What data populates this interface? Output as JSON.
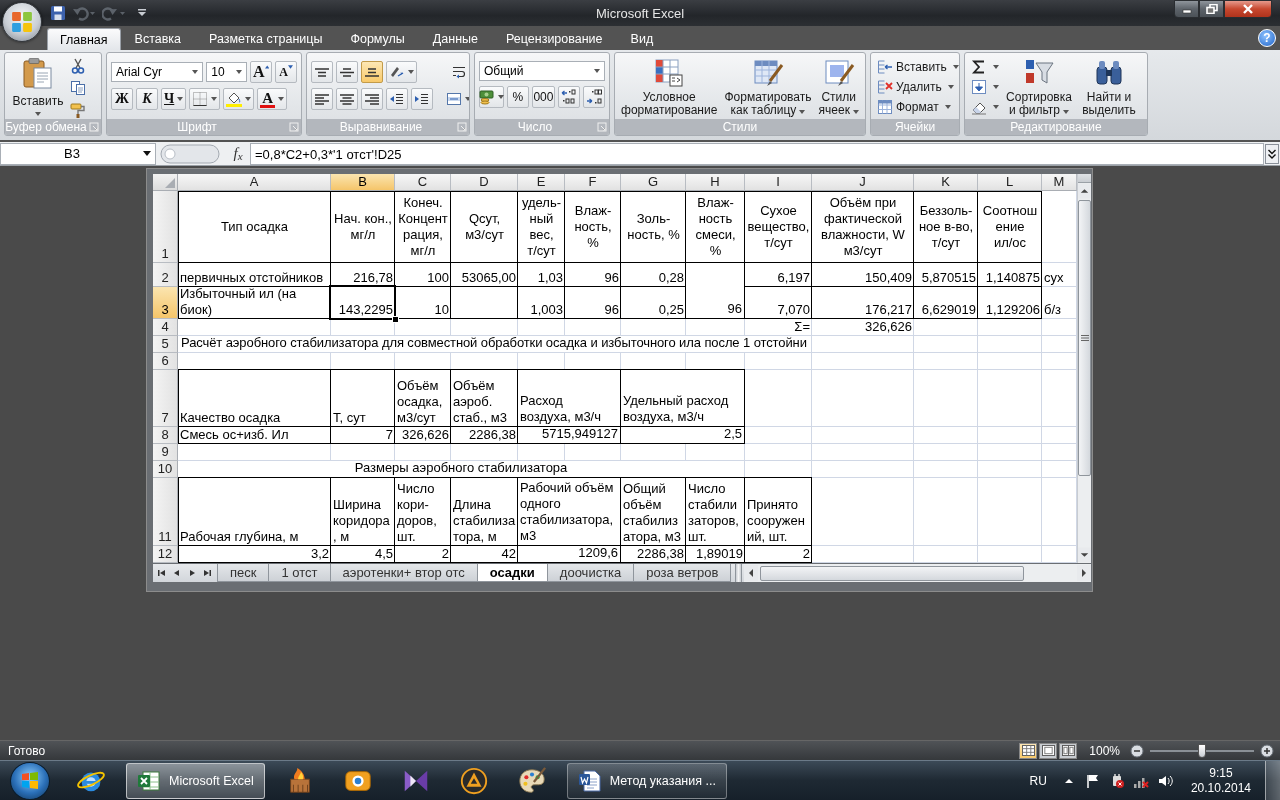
{
  "window": {
    "title": "Microsoft Excel"
  },
  "quick_access": [
    {
      "kind": "save",
      "disabled": false
    },
    {
      "kind": "undo",
      "disabled": true
    },
    {
      "kind": "redo",
      "disabled": true
    }
  ],
  "tabs": [
    {
      "label": "Главная",
      "selected": true
    },
    {
      "label": "Вставка",
      "selected": false
    },
    {
      "label": "Разметка страницы",
      "selected": false
    },
    {
      "label": "Формулы",
      "selected": false
    },
    {
      "label": "Данные",
      "selected": false
    },
    {
      "label": "Рецензирование",
      "selected": false
    },
    {
      "label": "Вид",
      "selected": false
    }
  ],
  "help": "?",
  "ribbon": {
    "clipboard": {
      "label": "Буфер обмена",
      "paste": "Вставить"
    },
    "font": {
      "label": "Шрифт",
      "name": "Arial Cyr",
      "size": "10",
      "grow": "A",
      "shrink": "A",
      "bold": "Ж",
      "italic": "К",
      "underline": "Ч",
      "foreground_letter": "A"
    },
    "alignment": {
      "label": "Выравнивание",
      "vertical": [
        {
          "kind": "top",
          "selected": false
        },
        {
          "kind": "middle",
          "selected": false
        },
        {
          "kind": "bottom",
          "selected": true
        }
      ],
      "horizontal": [
        {
          "kind": "left",
          "selected": false
        },
        {
          "kind": "center",
          "selected": false
        },
        {
          "kind": "right",
          "selected": false
        }
      ]
    },
    "number": {
      "label": "Число",
      "format": "Общий",
      "percent": "%",
      "thousands": "000"
    },
    "styles": {
      "label": "Стили",
      "buttons": [
        {
          "kind": "conditional",
          "label": "Условное форматирование"
        },
        {
          "kind": "table",
          "label": "Форматировать как таблицу"
        },
        {
          "kind": "cell_styles",
          "label": "Стили ячеек"
        }
      ]
    },
    "cells": {
      "label": "Ячейки",
      "buttons": [
        {
          "kind": "insert",
          "label": "Вставить"
        },
        {
          "kind": "delete",
          "label": "Удалить"
        },
        {
          "kind": "format",
          "label": "Формат"
        }
      ]
    },
    "editing": {
      "label": "Редактирование",
      "buttons": [
        {
          "kind": "sort",
          "label": "Сортировка и фильтр"
        },
        {
          "kind": "find",
          "label": "Найти и выделить"
        }
      ]
    }
  },
  "formula_bar": {
    "name_box": "B3",
    "function_button": "f$_{x}$",
    "formula": "=0,8*C2+0,3*'1 отст'!D25"
  },
  "sheet": {
    "columns": [
      {
        "label": "A",
        "selected": false
      },
      {
        "label": "B",
        "selected": true
      },
      {
        "label": "C",
        "selected": false
      },
      {
        "label": "D",
        "selected": false
      },
      {
        "label": "E",
        "selected": false
      },
      {
        "label": "F",
        "selected": false
      },
      {
        "label": "G",
        "selected": false
      },
      {
        "label": "H",
        "selected": false
      },
      {
        "label": "I",
        "selected": false
      },
      {
        "label": "J",
        "selected": false
      },
      {
        "label": "K",
        "selected": false
      },
      {
        "label": "L",
        "selected": false
      },
      {
        "label": "M",
        "selected": false
      }
    ],
    "rows": [
      {
        "label": "1",
        "selected": false,
        "cells": [
          {
            "kind": "heading",
            "text": "Тип осадка"
          },
          {
            "kind": "heading",
            "text": "Нач. кон., мг/л"
          },
          {
            "kind": "heading",
            "text": "Конеч. Концентрация, мг/л"
          },
          {
            "kind": "heading",
            "text": "Qсут, м3/сут"
          },
          {
            "kind": "heading",
            "text": "удель-ный вес, т/сут"
          },
          {
            "kind": "heading",
            "text": "Влаж-ность, %"
          },
          {
            "kind": "heading",
            "text": "Золь-ность, %"
          },
          {
            "kind": "heading",
            "text": "Влаж-ность смеси, %"
          },
          {
            "kind": "heading",
            "text": "Сухое вещество, т/сут"
          },
          {
            "kind": "heading",
            "text": "Объём при фактической влажности, W м3/сут"
          },
          {
            "kind": "heading",
            "text": "Беззоль-ное в-во, т/сут"
          },
          {
            "kind": "heading",
            "text": "Соотношение ил/ос"
          }
        ]
      },
      {
        "label": "2",
        "selected": false,
        "cells": [
          {
            "kind": "text",
            "text": "первичных отстойников"
          },
          {
            "kind": "value",
            "text": "216,78"
          },
          {
            "kind": "value",
            "text": "100"
          },
          {
            "kind": "value",
            "text": "53065,00"
          },
          {
            "kind": "value",
            "text": "1,03"
          },
          {
            "kind": "value",
            "text": "96"
          },
          {
            "kind": "value",
            "text": "0,28"
          },
          {
            "kind": "value",
            "text": "96"
          },
          {
            "kind": "value",
            "text": "6,197"
          },
          {
            "kind": "value",
            "text": "150,409"
          },
          {
            "kind": "value",
            "text": "5,870515"
          },
          {
            "kind": "value",
            "text": "1,140875"
          },
          {
            "kind": "text",
            "text": "сух"
          }
        ]
      },
      {
        "label": "3",
        "selected": true,
        "cells": [
          {
            "kind": "text",
            "text": "Избыточный ил (на биок)"
          },
          {
            "kind": "value",
            "text": "143,2295"
          },
          {
            "kind": "value",
            "text": "10"
          },
          {
            "kind": "empty"
          },
          {
            "kind": "value",
            "text": "1,003"
          },
          {
            "kind": "value",
            "text": "96"
          },
          {
            "kind": "value",
            "text": "0,25"
          },
          {
            "kind": "join_up"
          },
          {
            "kind": "value",
            "text": "7,070"
          },
          {
            "kind": "value",
            "text": "176,217"
          },
          {
            "kind": "value",
            "text": "6,629019"
          },
          {
            "kind": "value",
            "text": "1,129206"
          },
          {
            "kind": "text",
            "text": "б/з"
          }
        ]
      },
      {
        "label": "4",
        "selected": false,
        "cells": [
          {
            "kind": "empty"
          },
          {
            "kind": "empty"
          },
          {
            "kind": "empty"
          },
          {
            "kind": "empty"
          },
          {
            "kind": "empty"
          },
          {
            "kind": "empty"
          },
          {
            "kind": "empty"
          },
          {
            "kind": "empty"
          },
          {
            "kind": "value",
            "text": "Σ="
          },
          {
            "kind": "value",
            "text": "326,626"
          }
        ]
      },
      {
        "label": "5",
        "selected": false,
        "cells": [
          {
            "kind": "spill",
            "text": "Расчёт аэробного стабилизатора для совместной обработки осадка и избыточного ила после 1 отстойни"
          },
          {
            "kind": "join_left"
          },
          {
            "kind": "join_left"
          },
          {
            "kind": "join_left"
          },
          {
            "kind": "join_left"
          },
          {
            "kind": "join_left"
          },
          {
            "kind": "join_left"
          },
          {
            "kind": "join_left"
          },
          {
            "kind": "join_left"
          }
        ]
      },
      {
        "label": "6",
        "selected": false
      },
      {
        "label": "7",
        "selected": false,
        "cells": [
          {
            "kind": "text",
            "text": "Качество осадка"
          },
          {
            "kind": "text",
            "text": "Т, сут"
          },
          {
            "kind": "text",
            "text": "Объём осадка, м3/сут"
          },
          {
            "kind": "text",
            "text": "Объём аэроб. стаб., м3"
          },
          {
            "kind": "text",
            "text": "Расход воздуха, м3/ч"
          },
          {
            "kind": "join_left"
          },
          {
            "kind": "text",
            "text": "Удельный расход воздуха, м3/ч"
          },
          {
            "kind": "join_left"
          }
        ]
      },
      {
        "label": "8",
        "selected": false,
        "cells": [
          {
            "kind": "text",
            "text": "Смесь ос+изб. Ил"
          },
          {
            "kind": "value",
            "text": "7"
          },
          {
            "kind": "value",
            "text": "326,626"
          },
          {
            "kind": "value",
            "text": "2286,38"
          },
          {
            "kind": "value",
            "text": "5715,949127"
          },
          {
            "kind": "join_left"
          },
          {
            "kind": "value",
            "text": "2,5"
          },
          {
            "kind": "join_left"
          }
        ]
      },
      {
        "label": "9",
        "selected": false
      },
      {
        "label": "10",
        "selected": false,
        "cells": [
          {
            "kind": "title",
            "text": "Размеры аэробного стабилизатора"
          },
          {
            "kind": "join_left"
          },
          {
            "kind": "join_left"
          },
          {
            "kind": "join_left"
          },
          {
            "kind": "join_left"
          },
          {
            "kind": "join_left"
          },
          {
            "kind": "join_left"
          },
          {
            "kind": "join_left"
          }
        ]
      },
      {
        "label": "11",
        "selected": false,
        "cells": [
          {
            "kind": "text",
            "text": "Рабочая глубина, м"
          },
          {
            "kind": "text",
            "text": "Ширина коридора, м"
          },
          {
            "kind": "text",
            "text": "Число кори-доров, шт."
          },
          {
            "kind": "text",
            "text": "Длина стабилизатора, м"
          },
          {
            "kind": "text",
            "text": "Рабочий объём одного стабилизатора, м3"
          },
          {
            "kind": "join_left"
          },
          {
            "kind": "text",
            "text": "Общий объём стабилизатора, м3"
          },
          {
            "kind": "text",
            "text": "Число стабилизаторов, шт."
          },
          {
            "kind": "text",
            "text": "Принято сооружений, шт."
          }
        ]
      },
      {
        "label": "12",
        "selected": false,
        "cells": [
          {
            "kind": "value",
            "text": "3,2"
          },
          {
            "kind": "value",
            "text": "4,5"
          },
          {
            "kind": "value",
            "text": "2"
          },
          {
            "kind": "value",
            "text": "42"
          },
          {
            "kind": "value",
            "text": "1209,6"
          },
          {
            "kind": "join_left"
          },
          {
            "kind": "value",
            "text": "2286,38"
          },
          {
            "kind": "value",
            "text": "1,89019"
          },
          {
            "kind": "value",
            "text": "2"
          }
        ]
      }
    ],
    "tabs": [
      {
        "label": "песк",
        "selected": false
      },
      {
        "label": "1 отст",
        "selected": false
      },
      {
        "label": "аэротенки+ втор отс",
        "selected": false
      },
      {
        "label": "осадки",
        "selected": true
      },
      {
        "label": "доочистка",
        "selected": false
      },
      {
        "label": "роза ветров",
        "selected": false
      }
    ]
  },
  "status_bar": {
    "status": "Готово",
    "views": [
      {
        "kind": "normal",
        "selected": true
      },
      {
        "kind": "page_layout",
        "selected": false
      },
      {
        "kind": "page_break",
        "selected": false
      }
    ],
    "zoom": "100%",
    "zoom_slider": {
      "level": 0.5
    }
  },
  "taskbar": {
    "windows": [
      {
        "kind": "spreadsheet",
        "label": "Microsoft Excel",
        "selected": true
      },
      {
        "kind": "document",
        "label": "Метод указания ...",
        "selected": false
      }
    ],
    "tray": {
      "language": "RU",
      "time": "9:15",
      "date": "20.10.2014"
    }
  }
}
